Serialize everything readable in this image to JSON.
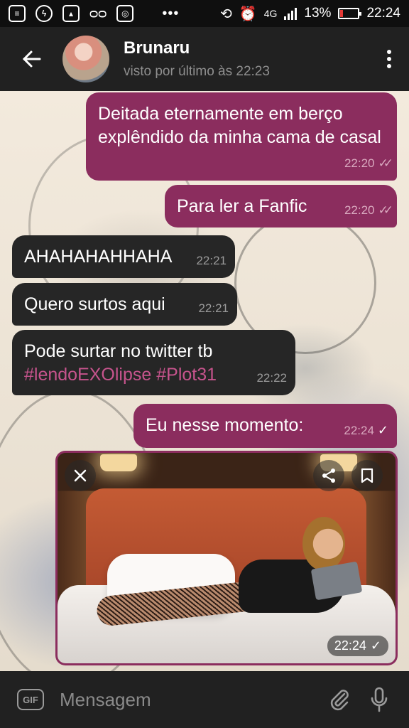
{
  "status_bar": {
    "network": "4G",
    "battery": "13%",
    "time": "22:24",
    "icons": [
      "message-icon",
      "messenger-icon",
      "gallery-icon",
      "voicemail-icon",
      "instagram-icon",
      "rotation-lock-icon",
      "alarm-icon",
      "signal-icon",
      "battery-low-icon"
    ]
  },
  "header": {
    "contact_name": "Brunaru",
    "last_seen": "visto por último às 22:23"
  },
  "messages": [
    {
      "text": "Deitada eternamente em berço explêndido da minha cama de casal",
      "time": "22:20",
      "direction": "outgoing",
      "read": true
    },
    {
      "text": "Para ler a Fanfic",
      "time": "22:20",
      "direction": "outgoing",
      "read": true
    },
    {
      "text": "AHAHAHAHHAHA",
      "time": "22:21",
      "direction": "incoming"
    },
    {
      "text": "Quero surtos aqui",
      "time": "22:21",
      "direction": "incoming"
    },
    {
      "text_line1": "Pode surtar no twitter tb",
      "hashtag1": "#lendoEXOlipse",
      "hashtag2": "#Plot31",
      "time": "22:22",
      "direction": "incoming"
    },
    {
      "text": "Eu nesse momento:",
      "time": "22:24",
      "direction": "outgoing",
      "read": false
    }
  ],
  "media": {
    "time": "22:24",
    "buttons": [
      "close-icon",
      "share-icon",
      "bookmark-icon"
    ]
  },
  "input": {
    "placeholder": "Mensagem",
    "gif_label": "GIF"
  },
  "colors": {
    "outgoing_bubble": "#8b2d5e",
    "incoming_bubble": "#262626",
    "hashtag": "#c7548d",
    "header": "#212121"
  }
}
